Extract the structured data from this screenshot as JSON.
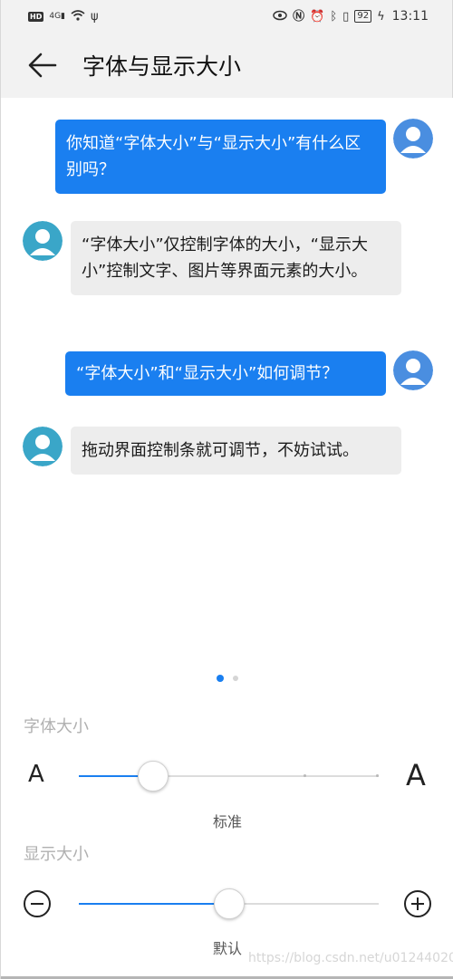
{
  "status_bar": {
    "left_badge": "HD",
    "network": "4G",
    "time": "13:11",
    "battery": "92"
  },
  "header": {
    "title": "字体与显示大小"
  },
  "chat": {
    "messages": [
      {
        "side": "out",
        "text": "你知道“字体大小”与“显示大小”有什么区别吗？"
      },
      {
        "side": "in",
        "text": "“字体大小”仅控制字体的大小，“显示大小”控制文字、图片等界面元素的大小。"
      },
      {
        "side": "out",
        "text": "“字体大小”和“显示大小”如何调节？"
      },
      {
        "side": "in",
        "text": "拖动界面控制条就可调节，不妨试试。"
      }
    ]
  },
  "pager": {
    "count": 2,
    "active": 1
  },
  "font_size": {
    "label": "字体大小",
    "small_icon": "A",
    "large_icon": "A",
    "caption": "标准",
    "steps": 4,
    "value_step": 1
  },
  "display_size": {
    "label": "显示大小",
    "minus_icon": "minus-circle-icon",
    "plus_icon": "plus-circle-icon",
    "caption": "默认",
    "value_fraction": 0.5
  },
  "watermark": "https://blog.csdn.net/u012440207",
  "colors": {
    "accent": "#1a7ff0",
    "incoming_bubble": "#ededed",
    "avatar_user": "#4a8ee0",
    "avatar_bot": "#3aa6c8"
  }
}
